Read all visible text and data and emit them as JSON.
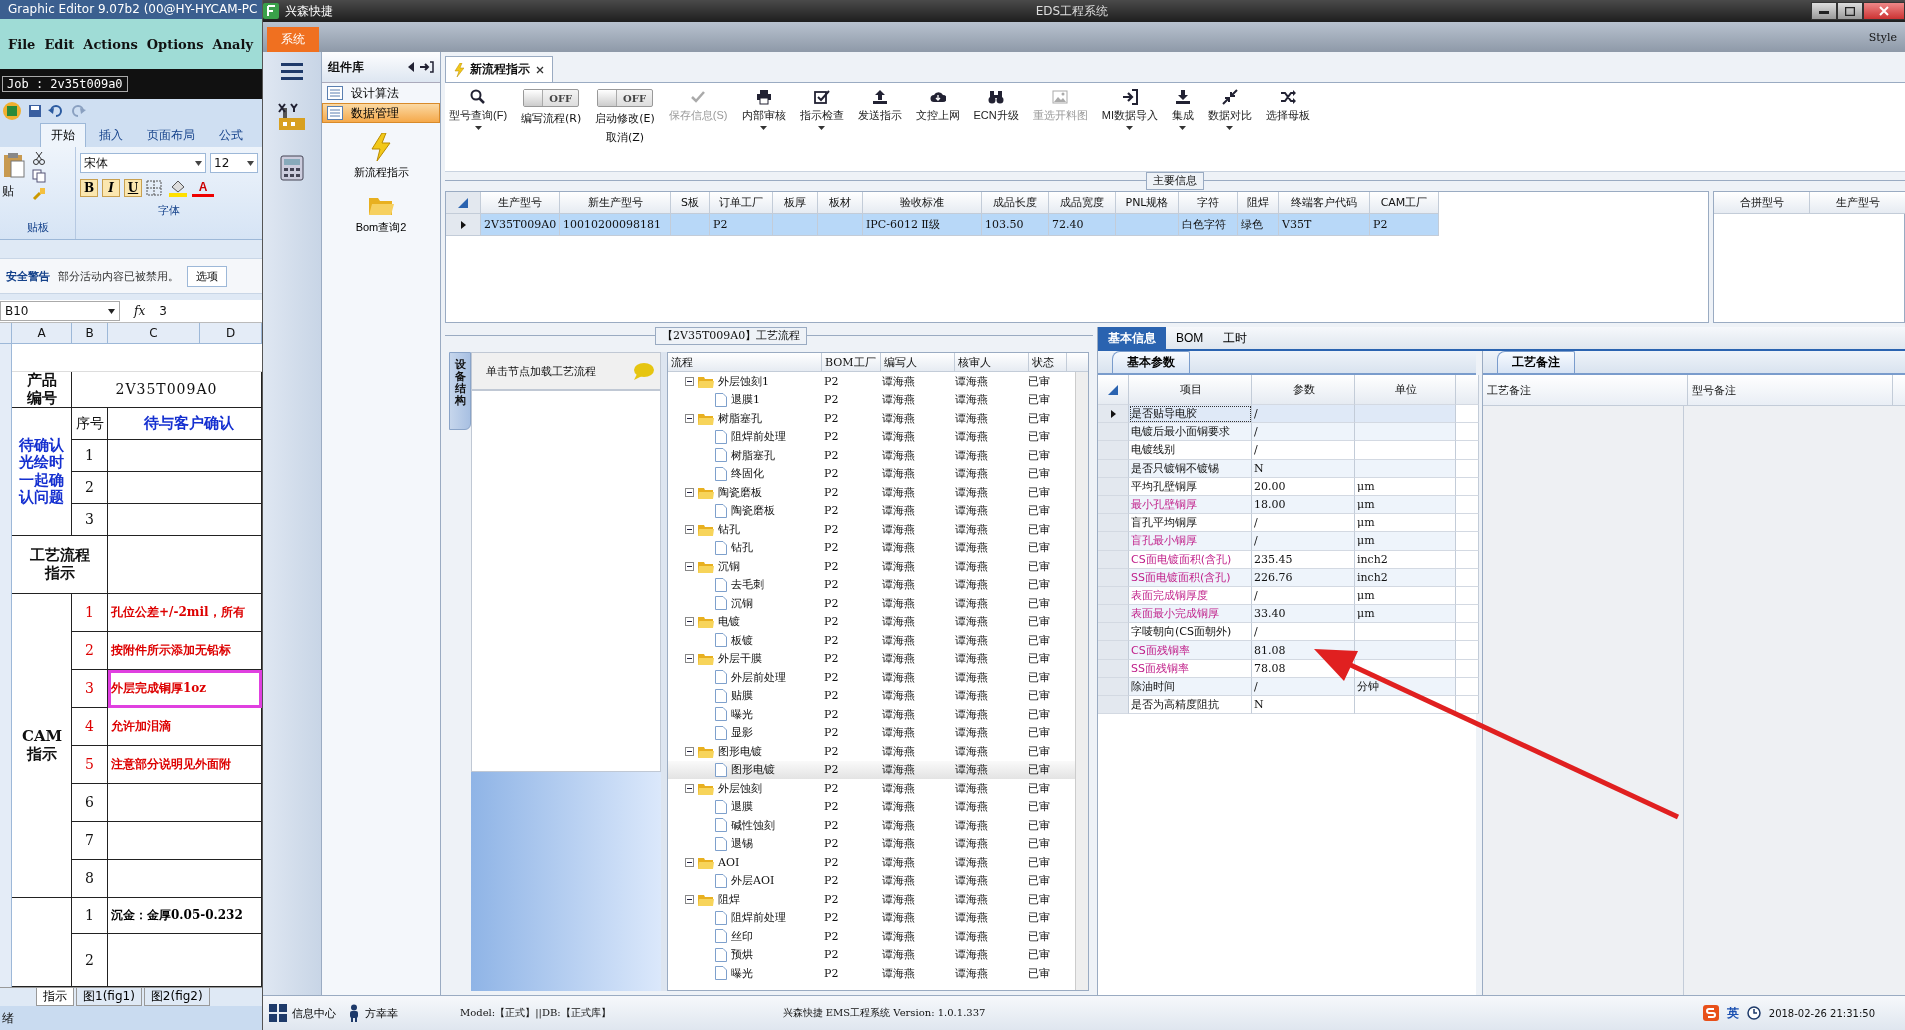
{
  "editor": {
    "title": "Graphic Editor 9.07b2 (00@HY-HYCAM-PC",
    "menu": [
      "File",
      "Edit",
      "Actions",
      "Options",
      "Analy"
    ],
    "job": "Job : 2v35t009a0"
  },
  "excel": {
    "tabs": [
      {
        "label": "开始",
        "selected": true
      },
      {
        "label": "插入",
        "selected": false
      },
      {
        "label": "页面布局",
        "selected": false
      },
      {
        "label": "公式",
        "selected": false
      }
    ],
    "paste_label": "贴",
    "clipboard_label": "贴板",
    "font_name": "宋体",
    "font_size": "12",
    "font_group": "字体",
    "format_buttons": [
      "B",
      "I",
      "U"
    ],
    "font_color_button": "A",
    "security": {
      "title": "安全警告",
      "message": "部分活动内容已被禁用。",
      "button": "选项"
    },
    "name_box": "B10",
    "formula_label": "fx",
    "formula": "3",
    "columns": [
      "A",
      "B",
      "C",
      "D"
    ],
    "sheet": {
      "product_label": "产品编号",
      "product_value": "2V35T009A0",
      "confirm": {
        "label": "待确认光绘时一起确认问题",
        "no_header": "序号",
        "header": "待与客户确认",
        "rows": [
          "1",
          "2",
          "3"
        ]
      },
      "process_label": "工艺流程指示",
      "cam": {
        "label": "CAM指示",
        "rows": [
          {
            "no": "1",
            "text": "孔位公差+/-2mil，所有",
            "boxed": false
          },
          {
            "no": "2",
            "text": "按附件所示添加无铅标",
            "boxed": false
          },
          {
            "no": "3",
            "text": "外层完成铜厚1oz",
            "boxed": true
          },
          {
            "no": "4",
            "text": "允许加泪滴",
            "boxed": false
          },
          {
            "no": "5",
            "text": "注意部分说明见外面附",
            "boxed": false
          },
          {
            "no": "6"
          },
          {
            "no": "7"
          },
          {
            "no": "8"
          }
        ]
      },
      "surface": {
        "rows": [
          {
            "no": "1",
            "text": "沉金：金厚0.05-0.232"
          },
          {
            "no": "2"
          }
        ]
      }
    },
    "sheet_tabs": [
      {
        "label": "指示",
        "selected": true
      },
      {
        "label": "图1(fig1)",
        "selected": false
      },
      {
        "label": "图2(fig2)",
        "selected": false
      }
    ],
    "status": "绪"
  },
  "app": {
    "title": "兴森快捷",
    "center_title": "EDS工程系统",
    "system_tab": "系统",
    "style_label": "Style"
  },
  "nav": {
    "panel_title": "组件库",
    "groups": [
      {
        "label": "设计算法",
        "selected": false
      },
      {
        "label": "数据管理",
        "selected": true
      }
    ],
    "tools": [
      {
        "label": "新流程指示",
        "kind": "lightning"
      },
      {
        "label": "Bom查询2",
        "kind": "folder"
      }
    ]
  },
  "doc_tabs": [
    {
      "label": "新流程指示",
      "selected": true
    }
  ],
  "toolbar": [
    {
      "kind": "button",
      "label": "型号查询(F)",
      "dropdown": true,
      "disabled": false
    },
    {
      "kind": "toggle",
      "label": "编写流程(R)",
      "state_text": "OFF",
      "on": false
    },
    {
      "kind": "toggle",
      "label": "启动修改(E)",
      "sublabel": "取消(Z)",
      "state_text": "OFF",
      "on": false
    },
    {
      "kind": "button",
      "label": "保存信息(S)",
      "dropdown": false,
      "disabled": true
    },
    {
      "kind": "button",
      "label": "内部审核",
      "dropdown": true,
      "disabled": false
    },
    {
      "kind": "button",
      "label": "指示检查",
      "dropdown": true,
      "disabled": false
    },
    {
      "kind": "button",
      "label": "发送指示",
      "dropdown": false,
      "disabled": false
    },
    {
      "kind": "button",
      "label": "文控上网",
      "dropdown": false,
      "disabled": false
    },
    {
      "kind": "button",
      "label": "ECN升级",
      "dropdown": false,
      "disabled": false
    },
    {
      "kind": "button",
      "label": "重选开料图",
      "dropdown": false,
      "disabled": true
    },
    {
      "kind": "button",
      "label": "MI数据导入",
      "dropdown": true,
      "disabled": false
    },
    {
      "kind": "button",
      "label": "集成",
      "dropdown": true,
      "disabled": false
    },
    {
      "kind": "button",
      "label": "数据对比",
      "dropdown": true,
      "disabled": false
    },
    {
      "kind": "button",
      "label": "选择母板",
      "dropdown": false,
      "disabled": false
    }
  ],
  "main_info": {
    "title": "主要信息",
    "columns": [
      "生产型号",
      "新生产型号",
      "S板",
      "订单工厂",
      "板厚",
      "板材",
      "验收标准",
      "成品长度",
      "成品宽度",
      "PNL规格",
      "字符",
      "阻焊",
      "终端客户代码",
      "CAM工厂"
    ],
    "rows": [
      {
        "selected": true,
        "cells": [
          "2V35T009A0",
          "10010200098181",
          null,
          "P2",
          null,
          null,
          "IPC-6012 Ⅱ级",
          "103.50",
          "72.40",
          null,
          "白色字符",
          "绿色",
          "V35T",
          "P2"
        ]
      }
    ],
    "side_columns": [
      "合拼型号",
      "生产型号"
    ]
  },
  "process": {
    "title": "【2V35T009A0】工艺流程",
    "side_tab": "设备结构",
    "hint": "单击节点加载工艺流程",
    "columns": [
      "流程",
      "BOM工厂",
      "编写人",
      "核审人",
      "状态"
    ],
    "tree": [
      {
        "name": "外层蚀刻1",
        "bom": "P2",
        "writer": "谭海燕",
        "reviewer": "谭海燕",
        "status": "已审",
        "selected": false,
        "expanded": true,
        "children": [
          {
            "name": "退膜1",
            "bom": "P2",
            "writer": "谭海燕",
            "reviewer": "谭海燕",
            "status": "已审",
            "selected": false
          }
        ]
      },
      {
        "name": "树脂塞孔",
        "bom": "P2",
        "writer": "谭海燕",
        "reviewer": "谭海燕",
        "status": "已审",
        "selected": false,
        "expanded": true,
        "children": [
          {
            "name": "阻焊前处理",
            "bom": "P2",
            "writer": "谭海燕",
            "reviewer": "谭海燕",
            "status": "已审",
            "selected": false
          },
          {
            "name": "树脂塞孔",
            "bom": "P2",
            "writer": "谭海燕",
            "reviewer": "谭海燕",
            "status": "已审",
            "selected": false
          },
          {
            "name": "终固化",
            "bom": "P2",
            "writer": "谭海燕",
            "reviewer": "谭海燕",
            "status": "已审",
            "selected": false
          }
        ]
      },
      {
        "name": "陶瓷磨板",
        "bom": "P2",
        "writer": "谭海燕",
        "reviewer": "谭海燕",
        "status": "已审",
        "selected": false,
        "expanded": true,
        "children": [
          {
            "name": "陶瓷磨板",
            "bom": "P2",
            "writer": "谭海燕",
            "reviewer": "谭海燕",
            "status": "已审",
            "selected": false
          }
        ]
      },
      {
        "name": "钻孔",
        "bom": "P2",
        "writer": "谭海燕",
        "reviewer": "谭海燕",
        "status": "已审",
        "selected": false,
        "expanded": true,
        "children": [
          {
            "name": "钻孔",
            "bom": "P2",
            "writer": "谭海燕",
            "reviewer": "谭海燕",
            "status": "已审",
            "selected": false
          }
        ]
      },
      {
        "name": "沉铜",
        "bom": "P2",
        "writer": "谭海燕",
        "reviewer": "谭海燕",
        "status": "已审",
        "selected": false,
        "expanded": true,
        "children": [
          {
            "name": "去毛刺",
            "bom": "P2",
            "writer": "谭海燕",
            "reviewer": "谭海燕",
            "status": "已审",
            "selected": false
          },
          {
            "name": "沉铜",
            "bom": "P2",
            "writer": "谭海燕",
            "reviewer": "谭海燕",
            "status": "已审",
            "selected": false
          }
        ]
      },
      {
        "name": "电镀",
        "bom": "P2",
        "writer": "谭海燕",
        "reviewer": "谭海燕",
        "status": "已审",
        "selected": false,
        "expanded": true,
        "children": [
          {
            "name": "板镀",
            "bom": "P2",
            "writer": "谭海燕",
            "reviewer": "谭海燕",
            "status": "已审",
            "selected": false
          }
        ]
      },
      {
        "name": "外层干膜",
        "bom": "P2",
        "writer": "谭海燕",
        "reviewer": "谭海燕",
        "status": "已审",
        "selected": false,
        "expanded": true,
        "children": [
          {
            "name": "外层前处理",
            "bom": "P2",
            "writer": "谭海燕",
            "reviewer": "谭海燕",
            "status": "已审",
            "selected": false
          },
          {
            "name": "贴膜",
            "bom": "P2",
            "writer": "谭海燕",
            "reviewer": "谭海燕",
            "status": "已审",
            "selected": false
          },
          {
            "name": "曝光",
            "bom": "P2",
            "writer": "谭海燕",
            "reviewer": "谭海燕",
            "status": "已审",
            "selected": false
          },
          {
            "name": "显影",
            "bom": "P2",
            "writer": "谭海燕",
            "reviewer": "谭海燕",
            "status": "已审",
            "selected": false
          }
        ]
      },
      {
        "name": "图形电镀",
        "bom": "P2",
        "writer": "谭海燕",
        "reviewer": "谭海燕",
        "status": "已审",
        "selected": false,
        "expanded": true,
        "children": [
          {
            "name": "图形电镀",
            "bom": "P2",
            "writer": "谭海燕",
            "reviewer": "谭海燕",
            "status": "已审",
            "selected": true
          }
        ]
      },
      {
        "name": "外层蚀刻",
        "bom": "P2",
        "writer": "谭海燕",
        "reviewer": "谭海燕",
        "status": "已审",
        "selected": false,
        "expanded": true,
        "children": [
          {
            "name": "退膜",
            "bom": "P2",
            "writer": "谭海燕",
            "reviewer": "谭海燕",
            "status": "已审",
            "selected": false
          },
          {
            "name": "碱性蚀刻",
            "bom": "P2",
            "writer": "谭海燕",
            "reviewer": "谭海燕",
            "status": "已审",
            "selected": false
          },
          {
            "name": "退锡",
            "bom": "P2",
            "writer": "谭海燕",
            "reviewer": "谭海燕",
            "status": "已审",
            "selected": false
          }
        ]
      },
      {
        "name": "AOI",
        "bom": "P2",
        "writer": "谭海燕",
        "reviewer": "谭海燕",
        "status": "已审",
        "selected": false,
        "expanded": true,
        "children": [
          {
            "name": "外层AOI",
            "bom": "P2",
            "writer": "谭海燕",
            "reviewer": "谭海燕",
            "status": "已审",
            "selected": false
          }
        ]
      },
      {
        "name": "阻焊",
        "bom": "P2",
        "writer": "谭海燕",
        "reviewer": "谭海燕",
        "status": "已审",
        "selected": false,
        "expanded": true,
        "children": [
          {
            "name": "阻焊前处理",
            "bom": "P2",
            "writer": "谭海燕",
            "reviewer": "谭海燕",
            "status": "已审",
            "selected": false
          },
          {
            "name": "丝印",
            "bom": "P2",
            "writer": "谭海燕",
            "reviewer": "谭海燕",
            "status": "已审",
            "selected": false
          },
          {
            "name": "预烘",
            "bom": "P2",
            "writer": "谭海燕",
            "reviewer": "谭海燕",
            "status": "已审",
            "selected": false
          },
          {
            "name": "曝光",
            "bom": "P2",
            "writer": "谭海燕",
            "reviewer": "谭海燕",
            "status": "已审",
            "selected": false
          }
        ]
      }
    ]
  },
  "details": {
    "tabs": [
      {
        "label": "基本信息",
        "selected": true
      },
      {
        "label": "BOM",
        "selected": false
      },
      {
        "label": "工时",
        "selected": false
      }
    ],
    "params_tab": "基本参数",
    "columns": [
      "项目",
      "参数",
      "单位"
    ],
    "rows": [
      {
        "item": "是否贴导电胶",
        "value": "/",
        "flagged": false,
        "selected": true
      },
      {
        "item": "电镀后最小面铜要求",
        "value": "/",
        "flagged": false,
        "selected": false
      },
      {
        "item": "电镀线别",
        "value": "/",
        "flagged": false,
        "selected": false
      },
      {
        "item": "是否只镀铜不镀锡",
        "value": "N",
        "flagged": false,
        "selected": false
      },
      {
        "item": "平均孔壁铜厚",
        "value": "20.00",
        "unit": "μm",
        "flagged": false,
        "selected": false
      },
      {
        "item": "最小孔壁铜厚",
        "value": "18.00",
        "unit": "μm",
        "flagged": true,
        "selected": false
      },
      {
        "item": "盲孔平均铜厚",
        "value": "/",
        "unit": "μm",
        "flagged": false,
        "selected": false
      },
      {
        "item": "盲孔最小铜厚",
        "value": "/",
        "unit": "μm",
        "flagged": true,
        "selected": false
      },
      {
        "item": "CS面电镀面积(含孔)",
        "value": "235.45",
        "unit": "inch2",
        "flagged": true,
        "selected": false
      },
      {
        "item": "SS面电镀面积(含孔)",
        "value": "226.76",
        "unit": "inch2",
        "flagged": true,
        "selected": false
      },
      {
        "item": "表面完成铜厚度",
        "value": "/",
        "unit": "μm",
        "flagged": true,
        "selected": false
      },
      {
        "item": "表面最小完成铜厚",
        "value": "33.40",
        "unit": "μm",
        "flagged": true,
        "selected": false
      },
      {
        "item": "字唛朝向(CS面朝外)",
        "value": "/",
        "flagged": false,
        "selected": false
      },
      {
        "item": "CS面残铜率",
        "value": "81.08",
        "flagged": true,
        "selected": false
      },
      {
        "item": "SS面残铜率",
        "value": "78.08",
        "flagged": true,
        "selected": false
      },
      {
        "item": "除油时间",
        "value": "/",
        "unit": "分钟",
        "flagged": false,
        "selected": false
      },
      {
        "item": "是否为高精度阻抗",
        "value": "N",
        "flagged": false,
        "selected": false
      }
    ],
    "notes_tab": "工艺备注",
    "notes_columns": [
      "工艺备注",
      "型号备注"
    ]
  },
  "status_bar": {
    "items": [
      {
        "label": "信息中心"
      },
      {
        "label": "方幸幸"
      }
    ],
    "db": "Model:【正式】||DB:【正式库】",
    "version": "兴森快捷 EMS工程系统 Version: 1.0.1.337",
    "ime": "英",
    "clock": "2018-02-26 21:31:50"
  }
}
